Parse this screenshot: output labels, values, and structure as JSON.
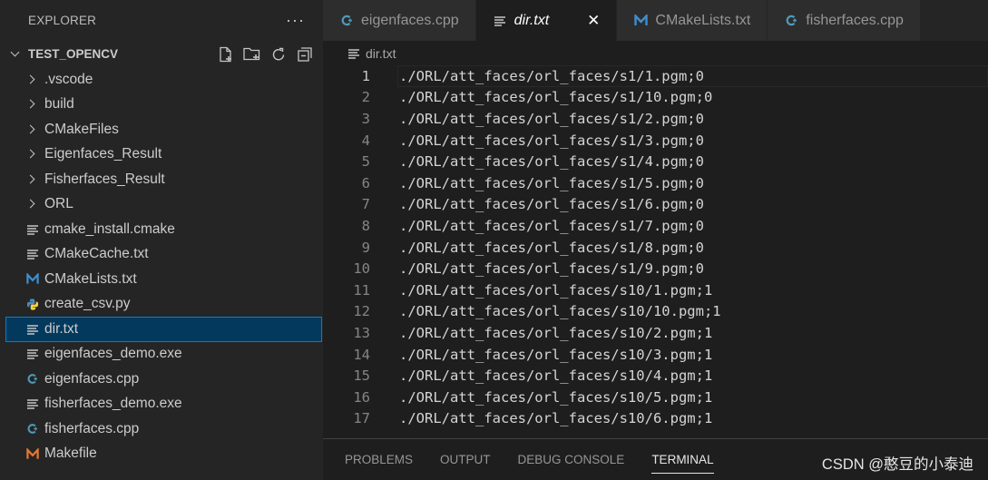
{
  "explorer": {
    "title": "EXPLORER",
    "more": "···",
    "folder": "TEST_OPENCV",
    "items": [
      {
        "label": ".vscode",
        "icon": "chevron-right-icon",
        "kind": "folder"
      },
      {
        "label": "build",
        "icon": "chevron-right-icon",
        "kind": "folder"
      },
      {
        "label": "CMakeFiles",
        "icon": "chevron-right-icon",
        "kind": "folder"
      },
      {
        "label": "Eigenfaces_Result",
        "icon": "chevron-right-icon",
        "kind": "folder"
      },
      {
        "label": "Fisherfaces_Result",
        "icon": "chevron-right-icon",
        "kind": "folder"
      },
      {
        "label": "ORL",
        "icon": "chevron-right-icon",
        "kind": "folder"
      },
      {
        "label": "cmake_install.cmake",
        "icon": "lines-file-icon",
        "kind": "file"
      },
      {
        "label": "CMakeCache.txt",
        "icon": "lines-file-icon",
        "kind": "file"
      },
      {
        "label": "CMakeLists.txt",
        "icon": "cmake-m-icon",
        "kind": "file"
      },
      {
        "label": "create_csv.py",
        "icon": "python-icon",
        "kind": "file"
      },
      {
        "label": "dir.txt",
        "icon": "lines-file-icon",
        "kind": "file"
      },
      {
        "label": "eigenfaces_demo.exe",
        "icon": "lines-file-icon",
        "kind": "file"
      },
      {
        "label": "eigenfaces.cpp",
        "icon": "cpp-icon",
        "kind": "file"
      },
      {
        "label": "fisherfaces_demo.exe",
        "icon": "lines-file-icon",
        "kind": "file"
      },
      {
        "label": "fisherfaces.cpp",
        "icon": "cpp-icon",
        "kind": "file"
      },
      {
        "label": "Makefile",
        "icon": "makefile-m-icon",
        "kind": "file"
      }
    ],
    "selected": "dir.txt"
  },
  "tabs": [
    {
      "label": "eigenfaces.cpp",
      "icon": "cpp-icon"
    },
    {
      "label": "dir.txt",
      "icon": "lines-file-icon",
      "close": "✕"
    },
    {
      "label": "CMakeLists.txt",
      "icon": "cmake-m-icon"
    },
    {
      "label": "fisherfaces.cpp",
      "icon": "cpp-icon"
    }
  ],
  "breadcrumb": "dir.txt",
  "editor": {
    "lines": [
      {
        "n": "1",
        "text": "./ORL/att_faces/orl_faces/s1/1.pgm;0"
      },
      {
        "n": "2",
        "text": "./ORL/att_faces/orl_faces/s1/10.pgm;0"
      },
      {
        "n": "3",
        "text": "./ORL/att_faces/orl_faces/s1/2.pgm;0"
      },
      {
        "n": "4",
        "text": "./ORL/att_faces/orl_faces/s1/3.pgm;0"
      },
      {
        "n": "5",
        "text": "./ORL/att_faces/orl_faces/s1/4.pgm;0"
      },
      {
        "n": "6",
        "text": "./ORL/att_faces/orl_faces/s1/5.pgm;0"
      },
      {
        "n": "7",
        "text": "./ORL/att_faces/orl_faces/s1/6.pgm;0"
      },
      {
        "n": "8",
        "text": "./ORL/att_faces/orl_faces/s1/7.pgm;0"
      },
      {
        "n": "9",
        "text": "./ORL/att_faces/orl_faces/s1/8.pgm;0"
      },
      {
        "n": "10",
        "text": "./ORL/att_faces/orl_faces/s1/9.pgm;0"
      },
      {
        "n": "11",
        "text": "./ORL/att_faces/orl_faces/s10/1.pgm;1"
      },
      {
        "n": "12",
        "text": "./ORL/att_faces/orl_faces/s10/10.pgm;1"
      },
      {
        "n": "13",
        "text": "./ORL/att_faces/orl_faces/s10/2.pgm;1"
      },
      {
        "n": "14",
        "text": "./ORL/att_faces/orl_faces/s10/3.pgm;1"
      },
      {
        "n": "15",
        "text": "./ORL/att_faces/orl_faces/s10/4.pgm;1"
      },
      {
        "n": "16",
        "text": "./ORL/att_faces/orl_faces/s10/5.pgm;1"
      },
      {
        "n": "17",
        "text": "./ORL/att_faces/orl_faces/s10/6.pgm;1"
      }
    ]
  },
  "panel": {
    "tabs": [
      "PROBLEMS",
      "OUTPUT",
      "DEBUG CONSOLE",
      "TERMINAL"
    ],
    "active": "TERMINAL"
  },
  "watermark": "CSDN @憨豆的小泰迪",
  "colors": {
    "selection_bg": "#04395e",
    "selection_border": "#007fd4",
    "cpp_icon": "#519aba",
    "cmake_icon": "#3e8ed0",
    "python_icon": "#3572a5",
    "makefile_icon": "#e37933"
  }
}
